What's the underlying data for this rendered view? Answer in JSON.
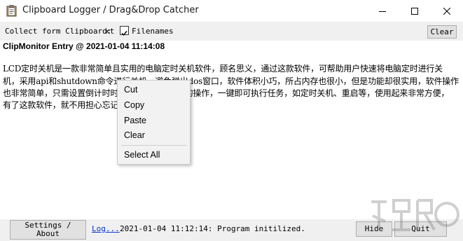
{
  "window": {
    "title": "Clipboard Logger / Drag&Drop Catcher",
    "icons": [
      "clipboard-icon",
      "minimize-icon",
      "maximize-icon",
      "close-icon"
    ]
  },
  "toolbar": {
    "collect_label": "Collect form Clipboard:",
    "collect_value": "xt",
    "filenames_label": "Filenames",
    "filenames_checked": true,
    "clear_label": "Clear"
  },
  "entry": {
    "header": "ClipMonitor Entry @ 2021-01-04 11:14:08",
    "lines": [
      "    LCD定时关机是一款非常简单且实用的电脑定时关机软件，顾名思义，通过这款软件，可帮助用户快速将电脑定时进行关",
      "机，采用api和shutdown命令进行关机，避免弹出dos窗口，软件体积小巧，所占内存也很小，但是功能却很实用，软件操作",
      "也非常简单，只需设置倒计时时间，无需进行复杂的操作，一键即可执行任务，如定时关机、重启等，使用起来非常方便，",
      "有了这款软件，就不用担心忘记关机了。"
    ]
  },
  "context_menu": {
    "items": [
      "Cut",
      "Copy",
      "Paste",
      "Clear",
      "Select All"
    ]
  },
  "bottom": {
    "settings_label": "Settings / About",
    "log_link": "Log...",
    "status": "2021-01-04 11:12:14: Program initilized.",
    "hide_label": "Hide",
    "quit_label": "Quit"
  }
}
